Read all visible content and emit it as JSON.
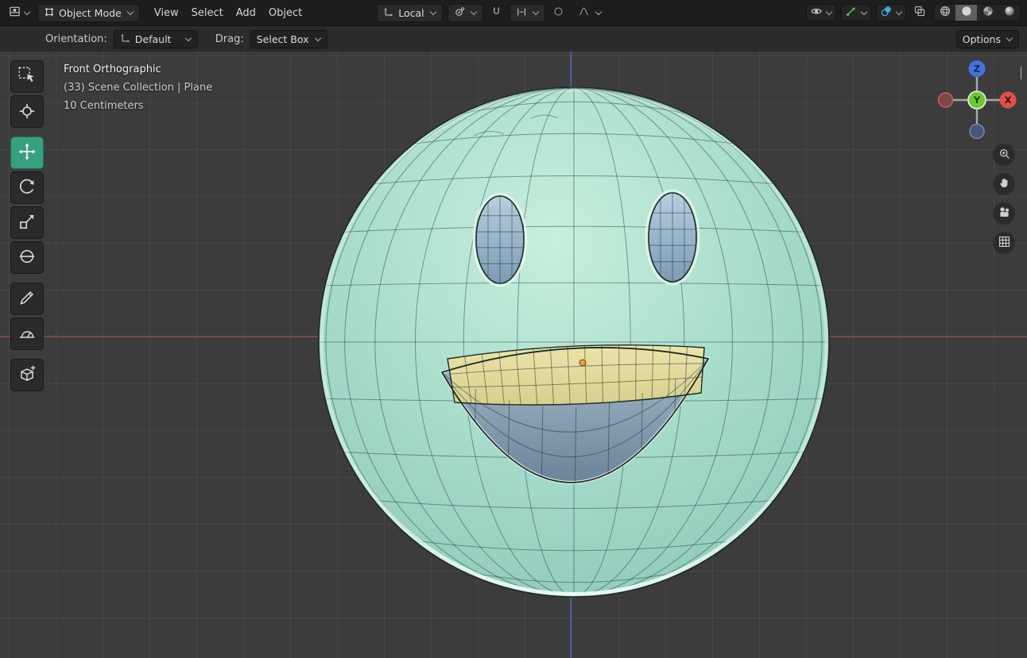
{
  "theme": {
    "header_bg": "#1d1d1d",
    "bar_bg": "#2b2b2b",
    "active_tool_color": "#36a080",
    "gizmos_on_color": "#57c05f",
    "overlays_on_color": "#4aa8dc"
  },
  "header": {
    "mode_dropdown": {
      "label": "Object Mode"
    },
    "menus": [
      {
        "label": "View"
      },
      {
        "label": "Select"
      },
      {
        "label": "Add"
      },
      {
        "label": "Object"
      }
    ],
    "orientation_dropdown": {
      "label": "Local"
    },
    "snap_enabled": false,
    "proportional_enabled": false,
    "gizmos_enabled": true,
    "overlays_enabled": true,
    "xray_enabled": false,
    "shading_modes": [
      {
        "name": "wireframe",
        "active": false
      },
      {
        "name": "solid",
        "active": true
      },
      {
        "name": "material-preview",
        "active": false
      },
      {
        "name": "rendered",
        "active": false
      }
    ]
  },
  "tool_settings": {
    "orientation_label": "Orientation:",
    "orientation_value": "Default",
    "drag_label": "Drag:",
    "drag_value": "Select Box",
    "options_label": "Options"
  },
  "toolbar": {
    "active_tool": "move",
    "tools": [
      {
        "name": "tweak-select",
        "icon": "tool-select-icon"
      },
      {
        "name": "cursor",
        "icon": "tool-cursor-icon"
      },
      {
        "name": "move",
        "icon": "tool-move-icon"
      },
      {
        "name": "rotate",
        "icon": "tool-rotate-icon"
      },
      {
        "name": "scale",
        "icon": "tool-scale-icon"
      },
      {
        "name": "transform",
        "icon": "tool-transform-icon"
      },
      {
        "name": "annotate",
        "icon": "tool-annotate-icon"
      },
      {
        "name": "measure",
        "icon": "tool-measure-icon"
      },
      {
        "name": "add-cube",
        "icon": "tool-add-cube-icon"
      }
    ]
  },
  "viewport": {
    "overlay_text": {
      "line1": "Front Orthographic",
      "line2": "(33) Scene Collection | Plane",
      "line3": "10 Centimeters"
    },
    "colors": {
      "background": "#3c3c3c",
      "grid_line": "#474747",
      "x_axis_line": "#8c4545",
      "z_axis_line": "#4d5ea6"
    },
    "axis_gizmo": {
      "x_label": "X",
      "y_label": "Y",
      "z_label": "Z",
      "x_color": "#e0504a",
      "y_color": "#6fc832",
      "z_color": "#4472dc",
      "neg_x_color": "#7e4747",
      "neg_z_color": "#47567a"
    },
    "model": {
      "name": "smiley-emoji-mesh",
      "sphere_light": "#c9eedd",
      "sphere_mid": "#a6dbca",
      "sphere_edge": "#8ec9b9",
      "outline": "#1b2b29",
      "wire": "#143432",
      "rim_light": "#eefcf4",
      "eye_top": "#b7cfdf",
      "eye_bottom": "#7d9ab3",
      "teeth_top": "#ece4a8",
      "teeth_bottom": "#d8cf8e",
      "mouth_top": "#a4bccb",
      "mouth_bottom": "#6c8499",
      "origin_color": "#ff9e4a"
    }
  },
  "icons": {
    "editor-type-icon": "3d-viewport",
    "object-mode-icon": "square-vertices",
    "chevron-down-icon": "caret",
    "orientation-icon": "axes-arrows",
    "pivot-point-icon": "circle-dot",
    "magnet-icon": "magnet",
    "snap-target-icon": "increment-bars",
    "proportional-icon": "circle-outline",
    "falloff-icon": "smooth-curve",
    "visibility-icon": "eye",
    "gizmos-icon": "arrow-dot",
    "overlays-icon": "overlap-circles",
    "xray-icon": "overlap-squares",
    "shading-wireframe-icon": "wire-sphere",
    "shading-solid-icon": "solid-sphere",
    "shading-material-icon": "checker-sphere",
    "shading-rendered-icon": "shaded-sphere",
    "tool-select-icon": "cursor-box",
    "tool-cursor-icon": "crosshair",
    "tool-move-icon": "move-arrows",
    "tool-rotate-icon": "rotate-arrows",
    "tool-scale-icon": "scale-arrow",
    "tool-transform-icon": "transform-gizmo",
    "tool-annotate-icon": "pencil",
    "tool-measure-icon": "protractor",
    "tool-add-cube-icon": "cube-plus",
    "zoom-icon": "magnifier",
    "pan-icon": "hand",
    "camera-icon": "movie-camera",
    "ortho-grid-icon": "grid",
    "sidebar-toggle-icon": "chevron-left",
    "origin-dot": "object-origin"
  }
}
